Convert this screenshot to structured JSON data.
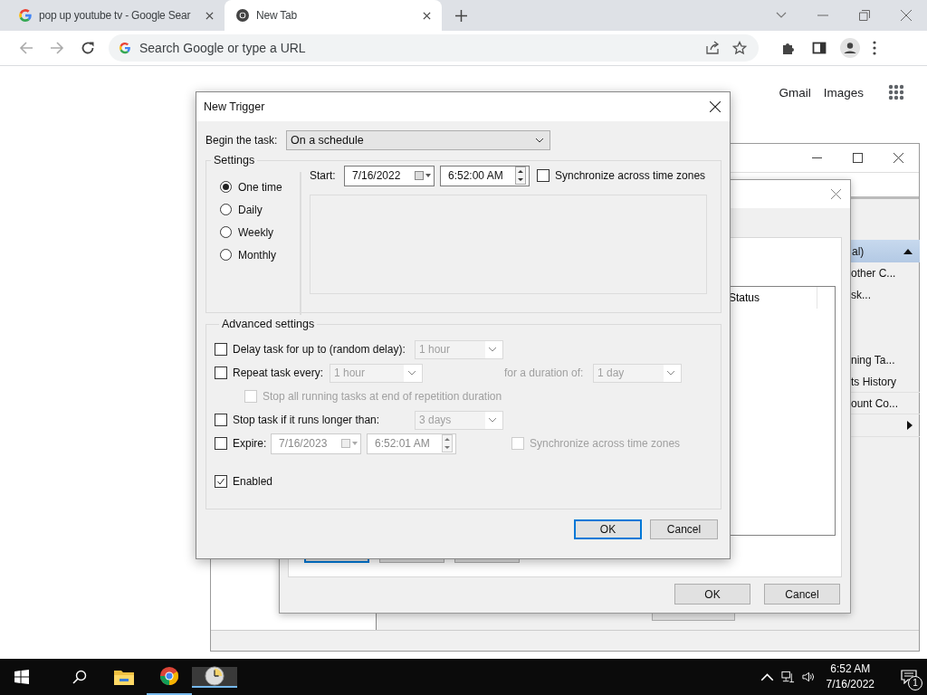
{
  "browser": {
    "tabs": [
      {
        "title": "pop up youtube tv - Google Sear",
        "selected": false
      },
      {
        "title": "New Tab",
        "selected": true
      }
    ],
    "omnibox": {
      "placeholder": "Search Google or type a URL"
    },
    "links": [
      "Gmail",
      "Images"
    ]
  },
  "task_scheduler": {
    "actions_header": {
      "label": "al)",
      "expanded": true
    },
    "actions": [
      {
        "label": "other C..."
      },
      {
        "label": "sk..."
      },
      {
        "label": "ning Ta..."
      },
      {
        "label": "ts History"
      },
      {
        "label": "ount Co..."
      }
    ]
  },
  "task_properties": {
    "columns": [
      "Status"
    ],
    "buttons": [
      {
        "label": "OK"
      },
      {
        "label": "Cancel"
      }
    ]
  },
  "new_trigger": {
    "title": "New Trigger",
    "begin": {
      "label": "Begin the task:",
      "value": "On a schedule"
    },
    "settings": {
      "title": "Settings",
      "options": [
        {
          "label": "One time",
          "selected": true
        },
        {
          "label": "Daily",
          "selected": false
        },
        {
          "label": "Weekly",
          "selected": false
        },
        {
          "label": "Monthly",
          "selected": false
        }
      ],
      "start": {
        "label": "Start:",
        "date": "7/16/2022",
        "time": "6:52:00 AM"
      },
      "sync": {
        "label": "Synchronize across time zones",
        "checked": false
      }
    },
    "advanced": {
      "title": "Advanced settings",
      "delay": {
        "label": "Delay task for up to (random delay):",
        "checked": false,
        "value": "1 hour",
        "disabled": true
      },
      "repeat": {
        "label": "Repeat task every:",
        "checked": false,
        "value": "1 hour",
        "disabled": true,
        "duration_label": "for a duration of:",
        "duration_value": "1 day"
      },
      "stop_all": {
        "label": "Stop all running tasks at end of repetition duration",
        "checked": false,
        "disabled": true
      },
      "stop_longer": {
        "label": "Stop task if it runs longer than:",
        "checked": false,
        "value": "3 days",
        "disabled": true
      },
      "expire": {
        "label": "Expire:",
        "checked": false,
        "date": "7/16/2023",
        "time": "6:52:01 AM",
        "disabled": true,
        "sync_label": "Synchronize across time zones",
        "sync_checked": false
      },
      "enabled": {
        "label": "Enabled",
        "checked": true
      }
    },
    "buttons": [
      {
        "label": "OK",
        "default": true
      },
      {
        "label": "Cancel",
        "default": false
      }
    ]
  },
  "taskbar": {
    "apps": [
      {
        "kind": "explorer",
        "running": false,
        "active": false
      },
      {
        "kind": "chrome",
        "running": true,
        "active": false
      },
      {
        "kind": "scheduler",
        "running": true,
        "active": true
      }
    ],
    "time": "6:52 AM",
    "date": "7/16/2022",
    "notifications": "1"
  }
}
